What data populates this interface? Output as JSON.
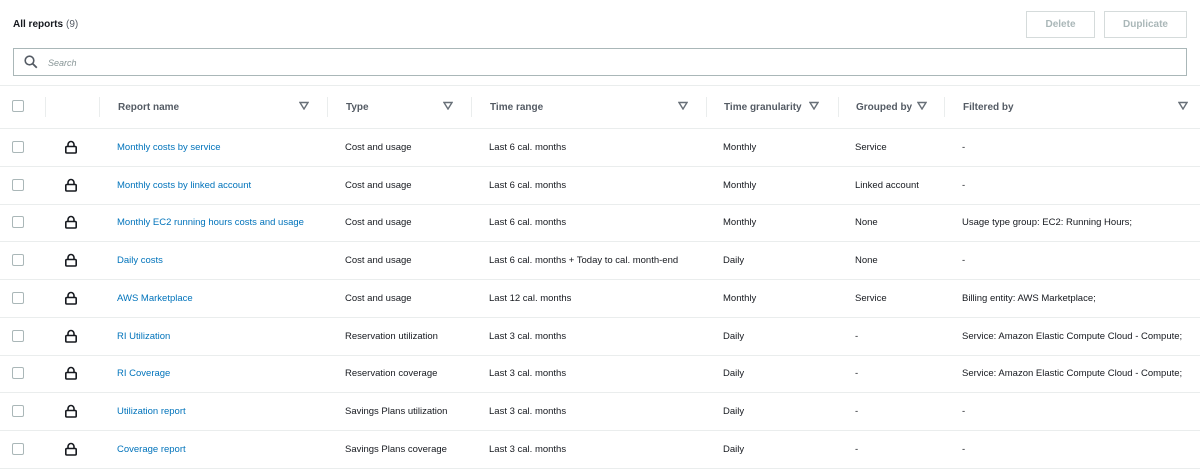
{
  "header": {
    "title": "All reports",
    "count": "(9)",
    "delete_label": "Delete",
    "duplicate_label": "Duplicate"
  },
  "search": {
    "placeholder": "Search"
  },
  "columns": [
    "Report name",
    "Type",
    "Time range",
    "Time granularity",
    "Grouped by",
    "Filtered by"
  ],
  "rows": [
    {
      "name": "Monthly costs by service",
      "type": "Cost and usage",
      "range": "Last 6 cal. months",
      "gran": "Monthly",
      "group": "Service",
      "filter": "-"
    },
    {
      "name": "Monthly costs by linked account",
      "type": "Cost and usage",
      "range": "Last 6 cal. months",
      "gran": "Monthly",
      "group": "Linked account",
      "filter": "-"
    },
    {
      "name": "Monthly EC2 running hours costs and usage",
      "type": "Cost and usage",
      "range": "Last 6 cal. months",
      "gran": "Monthly",
      "group": "None",
      "filter": "Usage type group: EC2: Running Hours;"
    },
    {
      "name": "Daily costs",
      "type": "Cost and usage",
      "range": "Last 6 cal. months + Today to cal. month-end",
      "gran": "Daily",
      "group": "None",
      "filter": "-"
    },
    {
      "name": "AWS Marketplace",
      "type": "Cost and usage",
      "range": "Last 12 cal. months",
      "gran": "Monthly",
      "group": "Service",
      "filter": "Billing entity: AWS Marketplace;"
    },
    {
      "name": "RI Utilization",
      "type": "Reservation utilization",
      "range": "Last 3 cal. months",
      "gran": "Daily",
      "group": "-",
      "filter": "Service: Amazon Elastic Compute Cloud - Compute;"
    },
    {
      "name": "RI Coverage",
      "type": "Reservation coverage",
      "range": "Last 3 cal. months",
      "gran": "Daily",
      "group": "-",
      "filter": "Service: Amazon Elastic Compute Cloud - Compute;"
    },
    {
      "name": "Utilization report",
      "type": "Savings Plans utilization",
      "range": "Last 3 cal. months",
      "gran": "Daily",
      "group": "-",
      "filter": "-"
    },
    {
      "name": "Coverage report",
      "type": "Savings Plans coverage",
      "range": "Last 3 cal. months",
      "gran": "Daily",
      "group": "-",
      "filter": "-"
    }
  ]
}
